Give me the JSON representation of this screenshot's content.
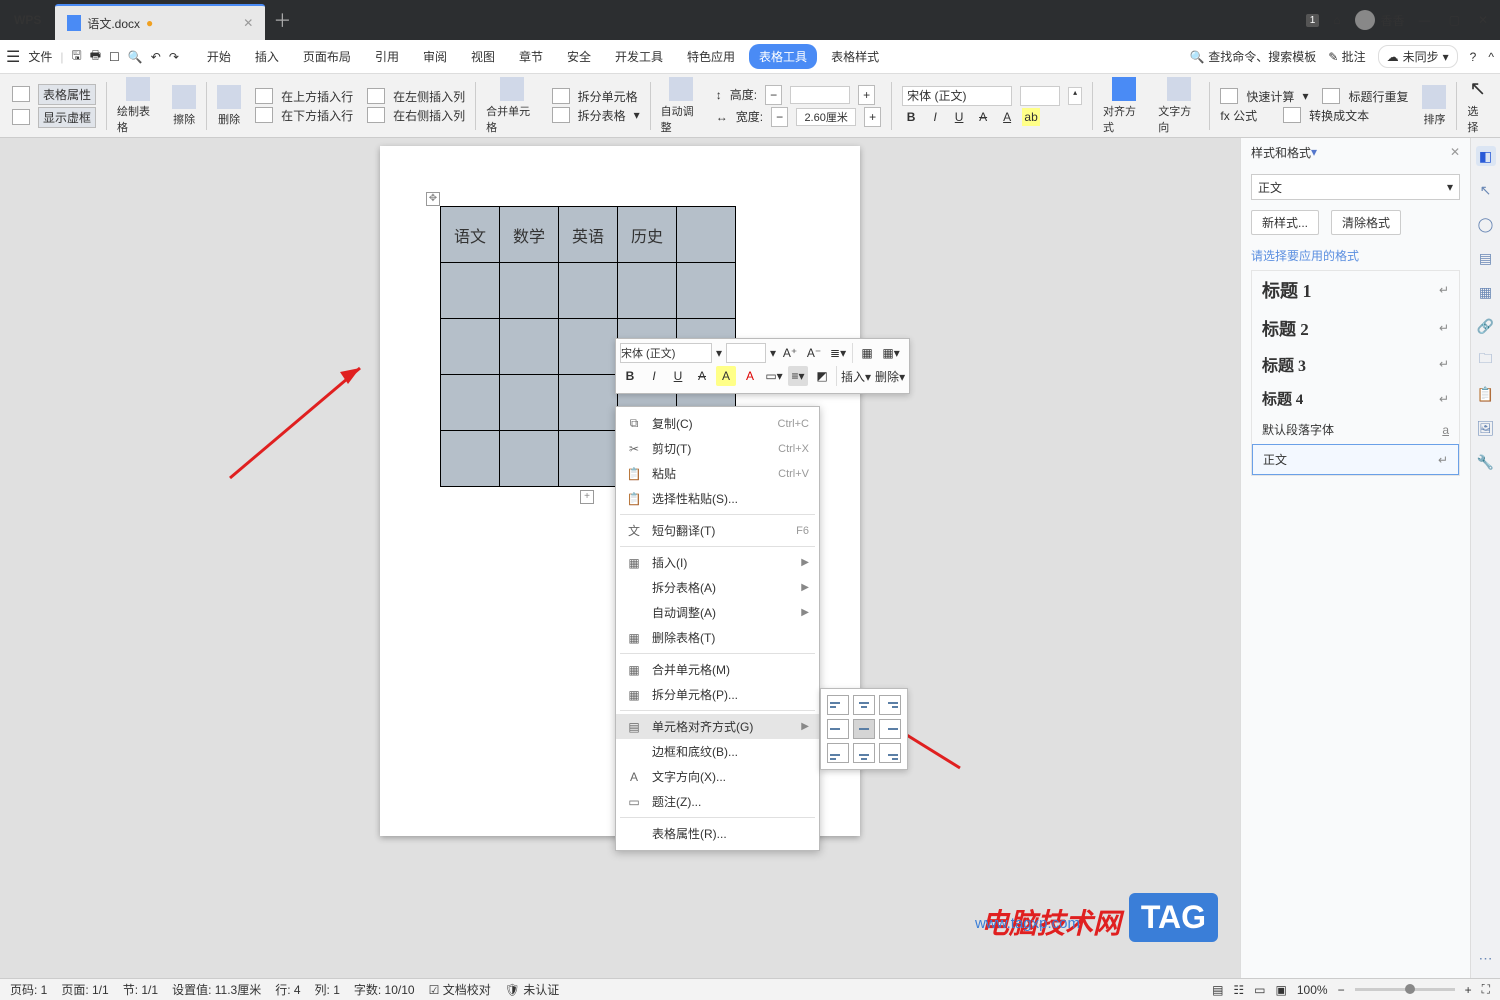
{
  "title": {
    "wps": "WPS",
    "doc": "语文.docx"
  },
  "titlebar": {
    "badge": "1",
    "user": "香香"
  },
  "menubar": {
    "file": "文件",
    "tabs": [
      "开始",
      "插入",
      "页面布局",
      "引用",
      "审阅",
      "视图",
      "章节",
      "安全",
      "开发工具",
      "特色应用",
      "表格工具",
      "表格样式"
    ],
    "active": 10,
    "search": "查找命令、搜索模板",
    "comment": "批注",
    "sync": "未同步"
  },
  "ribbon": {
    "props": "表格属性",
    "vframe": "显示虚框",
    "draw": "绘制表格",
    "erase": "擦除",
    "del": "删除",
    "ins_above": "在上方插入行",
    "ins_below": "在下方插入行",
    "ins_left": "在左侧插入列",
    "ins_right": "在右侧插入列",
    "merge": "合并单元格",
    "split_cell": "拆分单元格",
    "split_table": "拆分表格",
    "autofit": "自动调整",
    "height_l": "高度:",
    "width_l": "宽度:",
    "width_v": "2.60厘米",
    "font": "宋体 (正文)",
    "align": "对齐方式",
    "dir": "文字方向",
    "quick": "快速计算",
    "repeat": "标题行重复",
    "to_text": "转换成文本",
    "sort": "排序",
    "fx": "fx 公式",
    "select": "选择"
  },
  "table": {
    "headers": [
      "语文",
      "数学",
      "英语",
      "历史"
    ]
  },
  "mini": {
    "font": "宋体 (正文)",
    "ins": "插入",
    "del": "删除"
  },
  "context": {
    "copy": "复制(C)",
    "cut": "剪切(T)",
    "paste": "粘贴",
    "sc_copy": "Ctrl+C",
    "sc_cut": "Ctrl+X",
    "sc_paste": "Ctrl+V",
    "paste_sp": "选择性粘贴(S)...",
    "translate": "短句翻译(T)",
    "sc_tr": "F6",
    "insert": "插入(I)",
    "split_tbl": "拆分表格(A)",
    "autofit": "自动调整(A)",
    "del_tbl": "删除表格(T)",
    "merge": "合并单元格(M)",
    "split_cell": "拆分单元格(P)...",
    "align": "单元格对齐方式(G)",
    "border": "边框和底纹(B)...",
    "dir": "文字方向(X)...",
    "caption": "题注(Z)...",
    "props": "表格属性(R)..."
  },
  "panel": {
    "title": "样式和格式",
    "current": "正文",
    "new": "新样式...",
    "clear": "清除格式",
    "hint": "请选择要应用的格式",
    "items": [
      "标题 1",
      "标题 2",
      "标题 3",
      "标题 4",
      "默认段落字体",
      "正文"
    ]
  },
  "status": {
    "page_no": "页码: 1",
    "page": "页面: 1/1",
    "section": "节: 1/1",
    "setval": "设置值: 11.3厘米",
    "line": "行: 4",
    "col": "列: 1",
    "chars": "字数: 10/10",
    "spell": "文档校对",
    "auth": "未认证",
    "zoom": "100%"
  },
  "wm": {
    "text": "电脑技术网",
    "url": "www.tagxp.com",
    "tag": "TAG"
  }
}
